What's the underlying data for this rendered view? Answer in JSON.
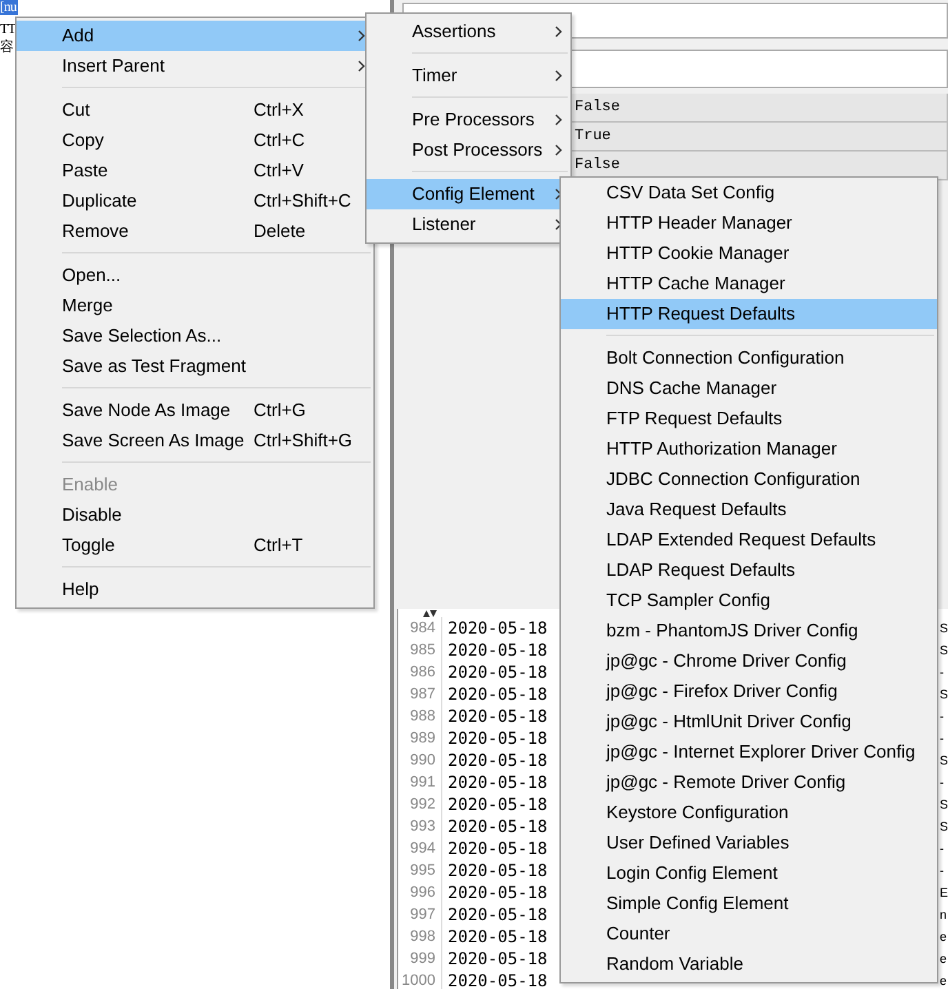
{
  "tree": {
    "items": [
      {
        "label": "[nu",
        "selected": true
      },
      {
        "label": "TT",
        "selected": false
      },
      {
        "label": "容",
        "selected": false
      }
    ]
  },
  "table": {
    "rows": [
      {
        "value": "False"
      },
      {
        "value": "True"
      },
      {
        "value": "False"
      }
    ]
  },
  "log": {
    "rows": [
      {
        "line": "984",
        "date": "2020-05-18",
        "cut": "S"
      },
      {
        "line": "985",
        "date": "2020-05-18",
        "cut": "S"
      },
      {
        "line": "986",
        "date": "2020-05-18",
        "cut": "-"
      },
      {
        "line": "987",
        "date": "2020-05-18",
        "cut": "S"
      },
      {
        "line": "988",
        "date": "2020-05-18",
        "cut": "-"
      },
      {
        "line": "989",
        "date": "2020-05-18",
        "cut": "-"
      },
      {
        "line": "990",
        "date": "2020-05-18",
        "cut": "S"
      },
      {
        "line": "991",
        "date": "2020-05-18",
        "cut": "-"
      },
      {
        "line": "992",
        "date": "2020-05-18",
        "cut": "S"
      },
      {
        "line": "993",
        "date": "2020-05-18",
        "cut": "S"
      },
      {
        "line": "994",
        "date": "2020-05-18",
        "cut": "-"
      },
      {
        "line": "995",
        "date": "2020-05-18",
        "cut": "-"
      },
      {
        "line": "996",
        "date": "2020-05-18",
        "cut": "E"
      },
      {
        "line": "997",
        "date": "2020-05-18",
        "cut": "n"
      },
      {
        "line": "998",
        "date": "2020-05-18",
        "cut": "e"
      },
      {
        "line": "999",
        "date": "2020-05-18",
        "cut": "e"
      },
      {
        "line": "1000",
        "date": "2020-05-18",
        "cut": "e"
      }
    ]
  },
  "context_menu": {
    "items": [
      {
        "kind": "item",
        "label": "Add",
        "submenu": true,
        "selected": true,
        "disabled": false
      },
      {
        "kind": "item",
        "label": "Insert Parent",
        "submenu": true,
        "selected": false,
        "disabled": false
      },
      {
        "kind": "separator"
      },
      {
        "kind": "item",
        "label": "Cut",
        "shortcut": "Ctrl+X",
        "selected": false,
        "disabled": false
      },
      {
        "kind": "item",
        "label": "Copy",
        "shortcut": "Ctrl+C",
        "selected": false,
        "disabled": false
      },
      {
        "kind": "item",
        "label": "Paste",
        "shortcut": "Ctrl+V",
        "selected": false,
        "disabled": false
      },
      {
        "kind": "item",
        "label": "Duplicate",
        "shortcut": "Ctrl+Shift+C",
        "selected": false,
        "disabled": false
      },
      {
        "kind": "item",
        "label": "Remove",
        "shortcut": "Delete",
        "selected": false,
        "disabled": false
      },
      {
        "kind": "separator"
      },
      {
        "kind": "item",
        "label": "Open...",
        "selected": false,
        "disabled": false
      },
      {
        "kind": "item",
        "label": "Merge",
        "selected": false,
        "disabled": false
      },
      {
        "kind": "item",
        "label": "Save Selection As...",
        "selected": false,
        "disabled": false
      },
      {
        "kind": "item",
        "label": "Save as Test Fragment",
        "selected": false,
        "disabled": false
      },
      {
        "kind": "separator"
      },
      {
        "kind": "item",
        "label": "Save Node As Image",
        "shortcut": "Ctrl+G",
        "selected": false,
        "disabled": false
      },
      {
        "kind": "item",
        "label": "Save Screen As Image",
        "shortcut": "Ctrl+Shift+G",
        "selected": false,
        "disabled": false
      },
      {
        "kind": "separator"
      },
      {
        "kind": "item",
        "label": "Enable",
        "selected": false,
        "disabled": true
      },
      {
        "kind": "item",
        "label": "Disable",
        "selected": false,
        "disabled": false
      },
      {
        "kind": "item",
        "label": "Toggle",
        "shortcut": "Ctrl+T",
        "selected": false,
        "disabled": false
      },
      {
        "kind": "separator"
      },
      {
        "kind": "item",
        "label": "Help",
        "selected": false,
        "disabled": false
      }
    ]
  },
  "add_submenu": {
    "items": [
      {
        "kind": "item",
        "label": "Assertions",
        "submenu": true,
        "selected": false
      },
      {
        "kind": "separator"
      },
      {
        "kind": "item",
        "label": "Timer",
        "submenu": true,
        "selected": false
      },
      {
        "kind": "separator"
      },
      {
        "kind": "item",
        "label": "Pre Processors",
        "submenu": true,
        "selected": false
      },
      {
        "kind": "item",
        "label": "Post Processors",
        "submenu": true,
        "selected": false
      },
      {
        "kind": "separator"
      },
      {
        "kind": "item",
        "label": "Config Element",
        "submenu": true,
        "selected": true
      },
      {
        "kind": "item",
        "label": "Listener",
        "submenu": true,
        "selected": false
      }
    ]
  },
  "config_submenu": {
    "items": [
      {
        "kind": "item",
        "label": "CSV Data Set Config",
        "selected": false
      },
      {
        "kind": "item",
        "label": "HTTP Header Manager",
        "selected": false
      },
      {
        "kind": "item",
        "label": "HTTP Cookie Manager",
        "selected": false
      },
      {
        "kind": "item",
        "label": "HTTP Cache Manager",
        "selected": false
      },
      {
        "kind": "item",
        "label": "HTTP Request Defaults",
        "selected": true
      },
      {
        "kind": "separator"
      },
      {
        "kind": "item",
        "label": "Bolt Connection Configuration",
        "selected": false
      },
      {
        "kind": "item",
        "label": "DNS Cache Manager",
        "selected": false
      },
      {
        "kind": "item",
        "label": "FTP Request Defaults",
        "selected": false
      },
      {
        "kind": "item",
        "label": "HTTP Authorization Manager",
        "selected": false
      },
      {
        "kind": "item",
        "label": "JDBC Connection Configuration",
        "selected": false
      },
      {
        "kind": "item",
        "label": "Java Request Defaults",
        "selected": false
      },
      {
        "kind": "item",
        "label": "LDAP Extended Request Defaults",
        "selected": false
      },
      {
        "kind": "item",
        "label": "LDAP Request Defaults",
        "selected": false
      },
      {
        "kind": "item",
        "label": "TCP Sampler Config",
        "selected": false
      },
      {
        "kind": "item",
        "label": "bzm - PhantomJS Driver Config",
        "selected": false
      },
      {
        "kind": "item",
        "label": "jp@gc - Chrome Driver Config",
        "selected": false
      },
      {
        "kind": "item",
        "label": "jp@gc - Firefox Driver Config",
        "selected": false
      },
      {
        "kind": "item",
        "label": "jp@gc - HtmlUnit Driver Config",
        "selected": false
      },
      {
        "kind": "item",
        "label": "jp@gc - Internet Explorer Driver Config",
        "selected": false
      },
      {
        "kind": "item",
        "label": "jp@gc - Remote Driver Config",
        "selected": false
      },
      {
        "kind": "item",
        "label": "Keystore Configuration",
        "selected": false
      },
      {
        "kind": "item",
        "label": "User Defined Variables",
        "selected": false
      },
      {
        "kind": "item",
        "label": "Login Config Element",
        "selected": false
      },
      {
        "kind": "item",
        "label": "Simple Config Element",
        "selected": false
      },
      {
        "kind": "item",
        "label": "Counter",
        "selected": false
      },
      {
        "kind": "item",
        "label": "Random Variable",
        "selected": false
      }
    ]
  }
}
